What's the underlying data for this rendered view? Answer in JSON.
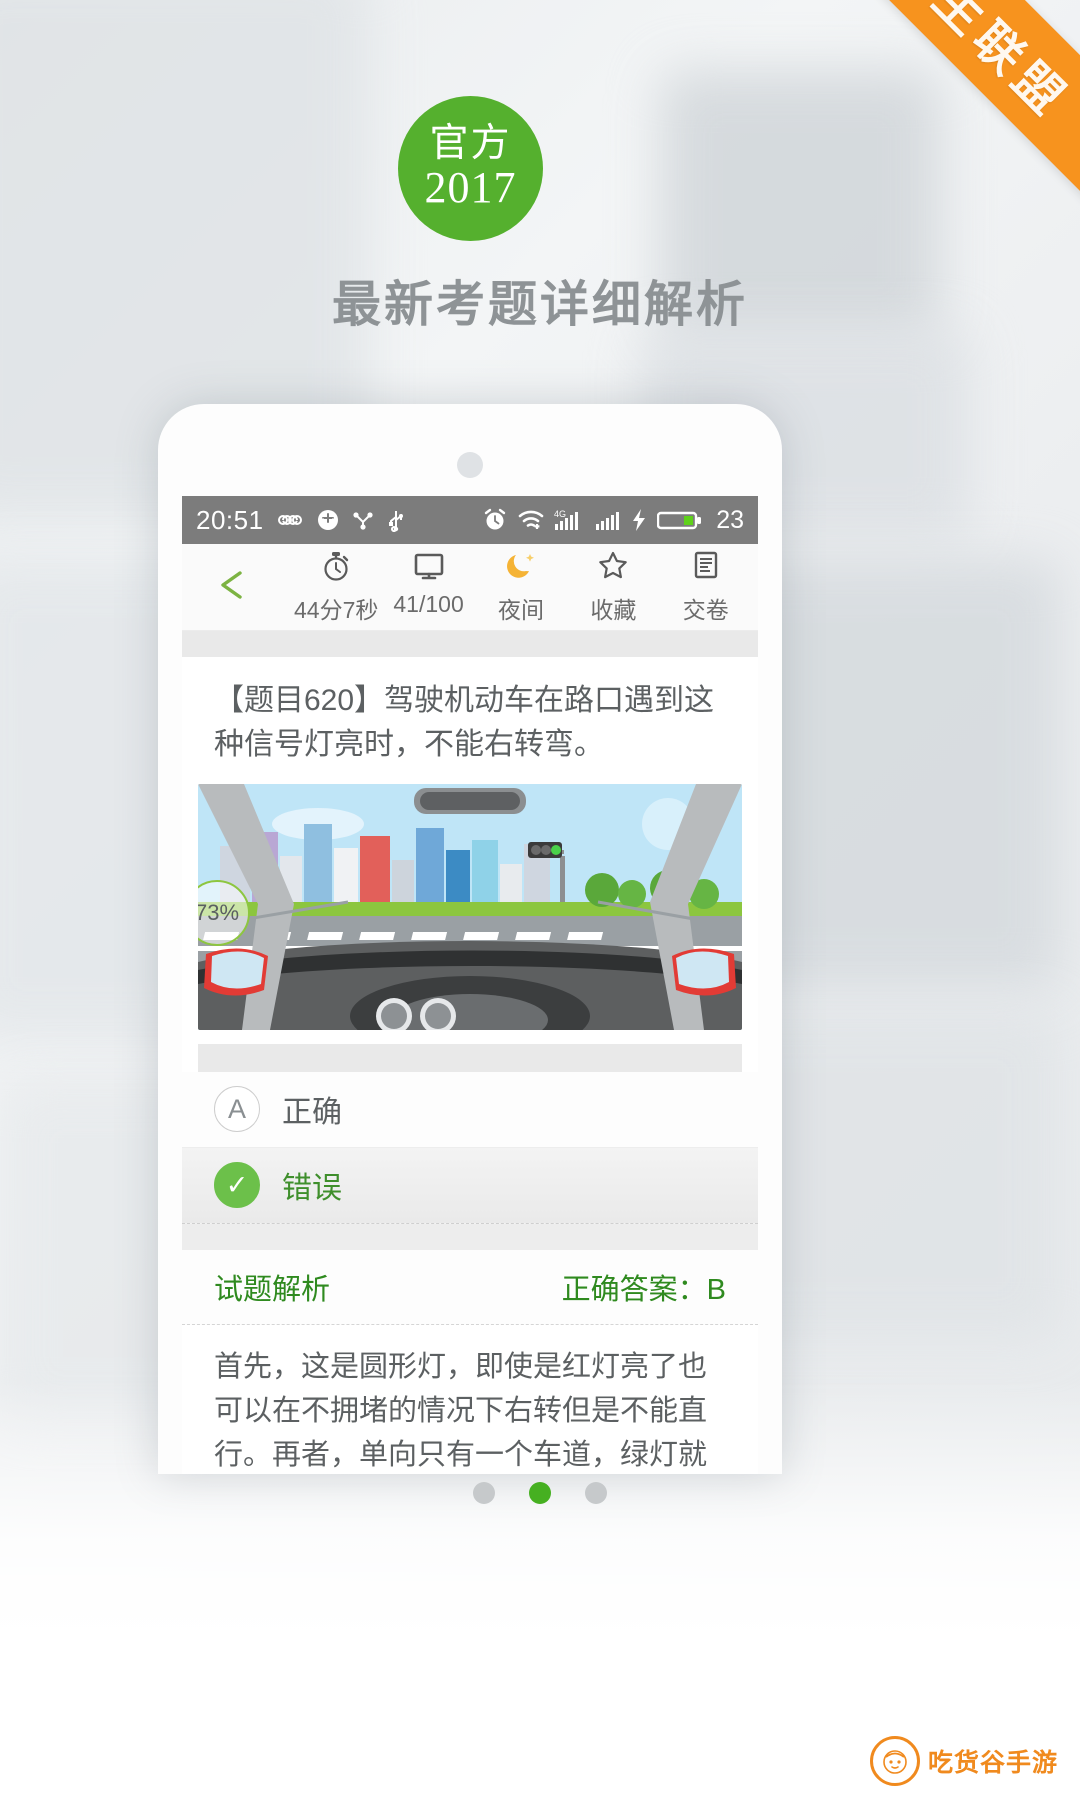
{
  "promo": {
    "ribbon_label": "大学生联盟",
    "badge_line1": "官方",
    "badge_line2": "2017",
    "headline": "最新考题详细解析",
    "accent_green": "#55b02e",
    "accent_orange": "#f7931e"
  },
  "phone": {
    "statusbar": {
      "time": "20:51",
      "battery_percent": "23",
      "icons": [
        "infinity-icon",
        "sync-icon",
        "share-icon",
        "usb-icon",
        "alarm-clock-icon",
        "wifi-icon",
        "signal-4g-icon",
        "signal-bars-icon",
        "charging-bolt-icon",
        "battery-icon"
      ]
    },
    "toolbar": {
      "back_icon": "back-arrow-icon",
      "items": [
        {
          "icon": "stopwatch-icon",
          "label": "44分7秒"
        },
        {
          "icon": "monitor-icon",
          "label": "41/100"
        },
        {
          "icon": "moon-icon",
          "label": "夜间"
        },
        {
          "icon": "star-icon",
          "label": "收藏"
        },
        {
          "icon": "document-icon",
          "label": "交卷"
        }
      ]
    },
    "question": {
      "text": "【题目620】驾驶机动车在路口遇到这种信号灯亮时，不能右转弯。",
      "image_progress": "73%"
    },
    "options": [
      {
        "mark": "A",
        "text": "正确",
        "selected": false
      },
      {
        "mark": "✓",
        "text": "错误",
        "selected": true
      }
    ],
    "explanation": {
      "title": "试题解析",
      "answer_label": "正确答案：B",
      "body": "首先，这是圆形灯，即使是红灯亮了也可以在不拥堵的情况下右转但是不能直行。再者，单向只有一个车道，绿灯就亮直行和右转都可以。"
    }
  },
  "footer": {
    "dots_count": 3,
    "active_dot_index": 1,
    "watermark": "吃货谷手游"
  }
}
